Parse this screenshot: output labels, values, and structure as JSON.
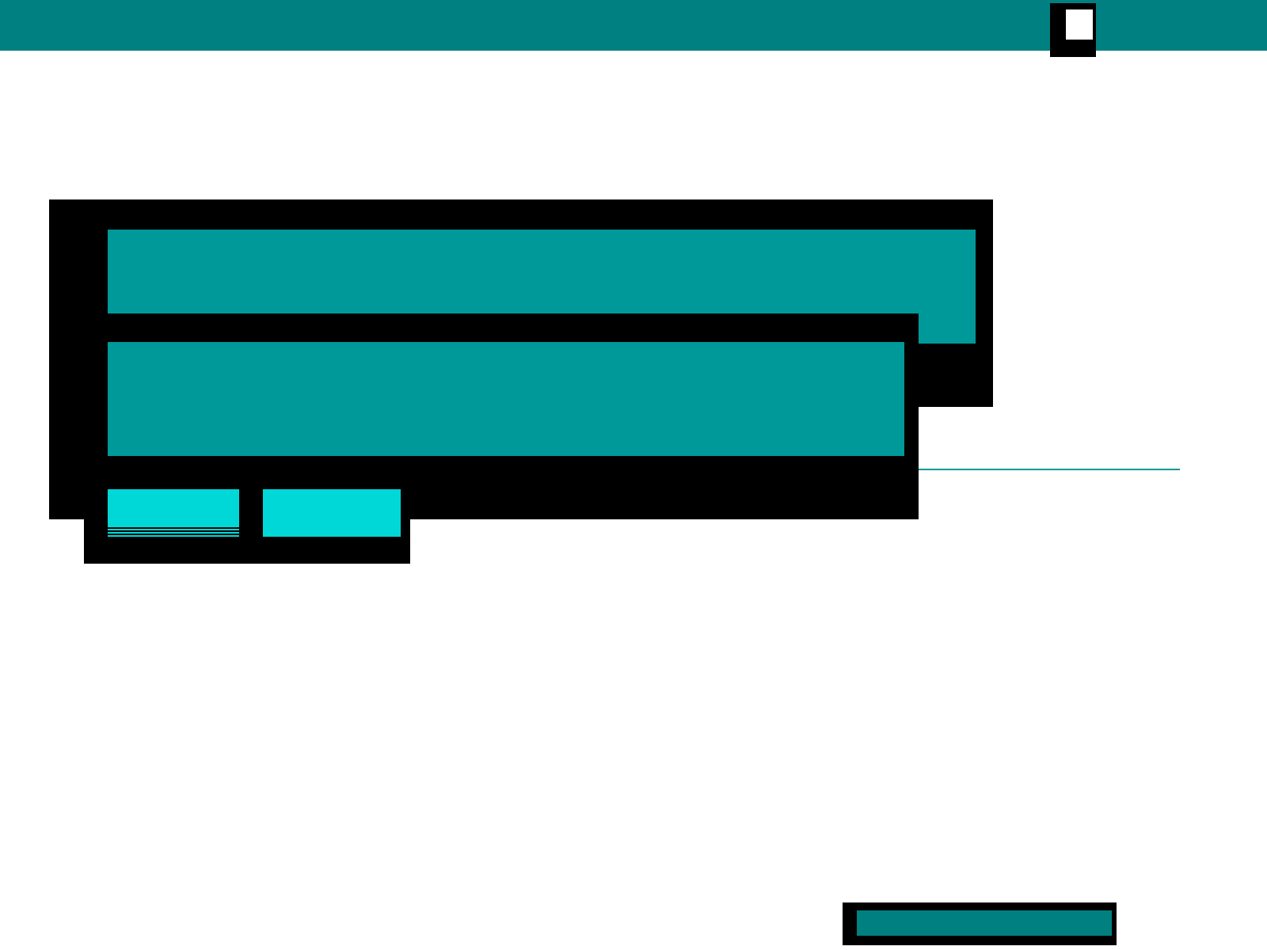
{
  "buttons": [
    {
      "focused": true
    },
    {
      "focused": false
    }
  ]
}
